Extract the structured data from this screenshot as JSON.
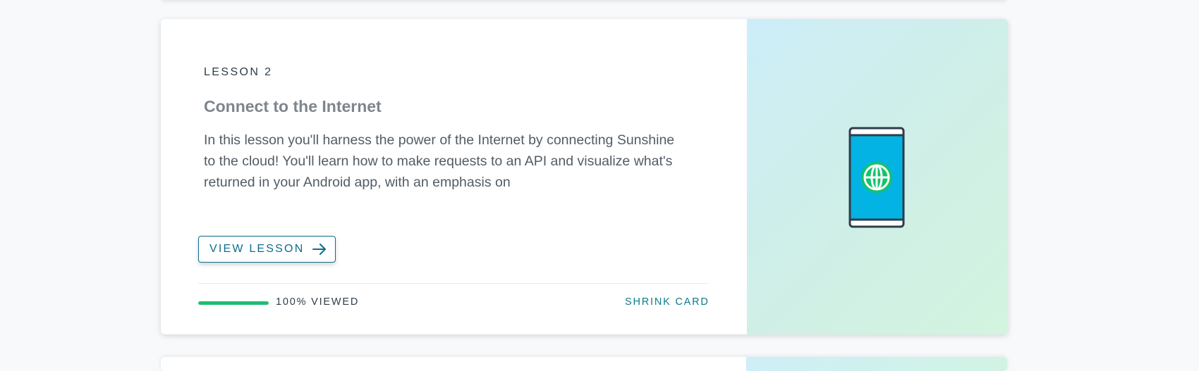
{
  "lesson": {
    "label": "LESSON 2",
    "title": "Connect to the Internet",
    "description": "In this lesson you'll harness the power of the Internet by connecting Sunshine to the cloud! You'll learn how to make requests to an API and visualize what's returned in your Android app, with an emphasis on",
    "view_button_label": "VIEW LESSON",
    "view_button_icon": "arrow-right-icon",
    "progress": {
      "percent": 100,
      "label": "100% VIEWED"
    },
    "shrink_label": "SHRINK CARD",
    "illustration_icon": "phone-globe-icon"
  },
  "colors": {
    "accent": "#0b6e8a",
    "progress": "#1fbd73",
    "heading": "#2e3d49",
    "title": "#7d868e",
    "body": "#525c65",
    "illustration_screen": "#02b3e4",
    "illustration_globe": "#15c26b"
  }
}
